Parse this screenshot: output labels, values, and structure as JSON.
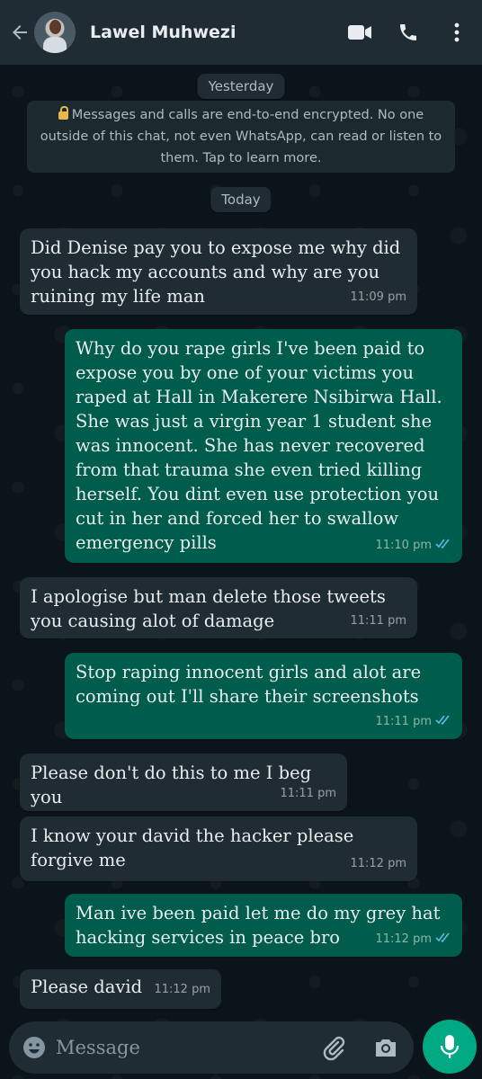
{
  "header": {
    "contact_name": "Lawel Muhwezi",
    "back_icon": "arrow-left-icon",
    "video_icon": "video-camera-icon",
    "call_icon": "phone-icon",
    "menu_icon": "more-vertical-icon"
  },
  "chat": {
    "date_yesterday": "Yesterday",
    "encryption_notice": "Messages and calls are end-to-end encrypted. No one outside of this chat, not even WhatsApp, can read or listen to them. Tap to learn more.",
    "date_today": "Today",
    "messages": [
      {
        "direction": "in",
        "text": "Did Denise pay you to expose me why did you hack my accounts and why are you ruining my life man",
        "time": "11:09 pm"
      },
      {
        "direction": "out",
        "text": "Why do you rape girls I've been paid to expose you by one of your victims you raped at Hall in Makerere Nsibirwa Hall. She was just a virgin year 1 student she was innocent. She has never recovered from that trauma she even tried killing herself. You dint even use protection you cut in her and forced her to swallow emergency pills",
        "time": "11:10 pm",
        "status": "read"
      },
      {
        "direction": "in",
        "text": "I apologise but man delete those tweets you causing alot of damage",
        "time": "11:11 pm"
      },
      {
        "direction": "out",
        "text": "Stop raping innocent girls and alot are coming out I'll share their screenshots",
        "time": "11:11 pm",
        "status": "read"
      },
      {
        "direction": "in",
        "text": "Please don't do this to me I beg you",
        "time": "11:11 pm"
      },
      {
        "direction": "in",
        "text": "I know your david the hacker please forgive me",
        "time": "11:12 pm"
      },
      {
        "direction": "out",
        "text": "Man ive been paid let me do my grey hat hacking services in peace bro",
        "time": "11:12 pm",
        "status": "read"
      },
      {
        "direction": "in",
        "text": "Please david",
        "time": "11:12 pm"
      }
    ]
  },
  "composer": {
    "placeholder": "Message",
    "emoji_icon": "emoji-icon",
    "attach_icon": "paperclip-icon",
    "camera_icon": "camera-icon",
    "mic_icon": "microphone-icon"
  },
  "colors": {
    "header_bg": "#1f2c33",
    "chat_bg": "#0b141a",
    "incoming_bubble": "#1f2c33",
    "outgoing_bubble": "#005c4b",
    "accent": "#00a884",
    "read_ticks": "#53bdeb"
  }
}
